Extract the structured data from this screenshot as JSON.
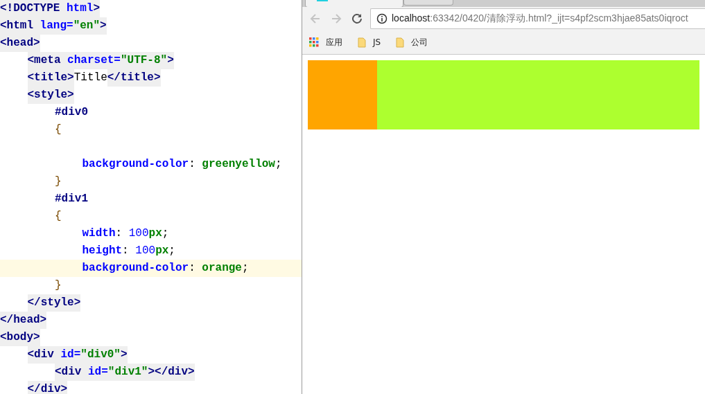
{
  "editor": {
    "lines": [
      {
        "current": false,
        "tokens": [
          {
            "kind": "tag",
            "text": "<!DOCTYPE "
          },
          {
            "kind": "tag-attr",
            "text": "html"
          },
          {
            "kind": "tag",
            "text": ">"
          }
        ]
      },
      {
        "current": false,
        "tokens": [
          {
            "kind": "tag",
            "text": "<html"
          },
          {
            "kind": "tag-attr",
            "text": " lang"
          },
          {
            "kind": "tag-attr",
            "text": "="
          },
          {
            "kind": "tag-value",
            "text": "\"en\""
          },
          {
            "kind": "tag",
            "text": ">"
          }
        ]
      },
      {
        "current": false,
        "tokens": [
          {
            "kind": "tag",
            "text": "<head>"
          }
        ],
        "children": [
          {
            "current": false,
            "tokens": [
              {
                "kind": "tag",
                "text": "<meta"
              },
              {
                "kind": "tag-attr",
                "text": " charset"
              },
              {
                "kind": "tag-attr",
                "text": "="
              },
              {
                "kind": "tag-value",
                "text": "\"UTF-8\""
              },
              {
                "kind": "tag",
                "text": ">"
              }
            ]
          },
          {
            "current": false,
            "tokens": [
              {
                "kind": "tag",
                "text": "<title>"
              },
              {
                "kind": "text",
                "text": "Title"
              },
              {
                "kind": "tag",
                "text": "</title>"
              }
            ]
          },
          {
            "current": false,
            "tokens": [
              {
                "kind": "tag",
                "text": "<style>"
              }
            ],
            "children": [
              {
                "current": false,
                "tokens": [
                  {
                    "kind": "selector",
                    "text": "#div0"
                  }
                ]
              },
              {
                "current": false,
                "tokens": [
                  {
                    "kind": "brace",
                    "text": "{"
                  }
                ],
                "children": [
                  {
                    "current": false
                  },
                  {
                    "current": false,
                    "tokens": [
                      {
                        "kind": "prop",
                        "text": "background-color"
                      },
                      {
                        "kind": "punct",
                        "text": ": "
                      },
                      {
                        "kind": "value",
                        "text": "greenyellow"
                      },
                      {
                        "kind": "punct",
                        "text": ";"
                      }
                    ]
                  }
                ]
              },
              {
                "current": false,
                "tokens": [
                  {
                    "kind": "brace",
                    "text": "}"
                  }
                ]
              },
              {
                "current": false,
                "tokens": [
                  {
                    "kind": "selector",
                    "text": "#div1"
                  }
                ]
              },
              {
                "current": false,
                "tokens": [
                  {
                    "kind": "brace",
                    "text": "{"
                  }
                ],
                "children": [
                  {
                    "current": false,
                    "tokens": [
                      {
                        "kind": "prop",
                        "text": "width"
                      },
                      {
                        "kind": "punct",
                        "text": ": "
                      },
                      {
                        "kind": "number",
                        "text": "100"
                      },
                      {
                        "kind": "value",
                        "text": "px"
                      },
                      {
                        "kind": "punct",
                        "text": ";"
                      }
                    ]
                  },
                  {
                    "current": false,
                    "tokens": [
                      {
                        "kind": "prop",
                        "text": "height"
                      },
                      {
                        "kind": "punct",
                        "text": ": "
                      },
                      {
                        "kind": "number",
                        "text": "100"
                      },
                      {
                        "kind": "value",
                        "text": "px"
                      },
                      {
                        "kind": "punct",
                        "text": ";"
                      }
                    ]
                  },
                  {
                    "current": true,
                    "tokens": [
                      {
                        "kind": "prop",
                        "text": "background-color"
                      },
                      {
                        "kind": "punct",
                        "text": ": "
                      },
                      {
                        "kind": "value",
                        "text": "orange"
                      },
                      {
                        "kind": "punct",
                        "text": ";"
                      }
                    ]
                  }
                ]
              },
              {
                "current": false,
                "tokens": [
                  {
                    "kind": "brace",
                    "text": "}"
                  }
                ]
              }
            ]
          },
          {
            "current": false,
            "tokens": [
              {
                "kind": "tag",
                "text": "</style>"
              }
            ]
          }
        ]
      },
      {
        "current": false,
        "tokens": [
          {
            "kind": "tag",
            "text": "</head>"
          }
        ]
      },
      {
        "current": false,
        "tokens": [
          {
            "kind": "tag",
            "text": "<body>"
          }
        ],
        "children": [
          {
            "current": false,
            "tokens": [
              {
                "kind": "tag",
                "text": "<div"
              },
              {
                "kind": "tag-attr",
                "text": " id"
              },
              {
                "kind": "tag-attr",
                "text": "="
              },
              {
                "kind": "tag-value",
                "text": "\"div0\""
              },
              {
                "kind": "tag",
                "text": ">"
              }
            ],
            "children": [
              {
                "current": false,
                "tokens": [
                  {
                    "kind": "tag",
                    "text": "<div"
                  },
                  {
                    "kind": "tag-attr",
                    "text": " id"
                  },
                  {
                    "kind": "tag-attr",
                    "text": "="
                  },
                  {
                    "kind": "tag-value",
                    "text": "\"div1\""
                  },
                  {
                    "kind": "tag",
                    "text": "></div>"
                  }
                ]
              }
            ]
          },
          {
            "current": false,
            "tokens": [
              {
                "kind": "tag",
                "text": "</div>"
              }
            ]
          }
        ]
      }
    ]
  },
  "browser": {
    "nav": {
      "back_disabled": true,
      "forward_disabled": true
    },
    "address": {
      "host": "localhost",
      "rest": ":63342/0420/清除浮动.html?_ijt=s4pf2scm3hjae85ats0iqroct"
    },
    "bookmarks": [
      {
        "kind": "apps",
        "label": "应用"
      },
      {
        "kind": "folder",
        "label": "JS"
      },
      {
        "kind": "folder",
        "label": "公司"
      }
    ]
  }
}
